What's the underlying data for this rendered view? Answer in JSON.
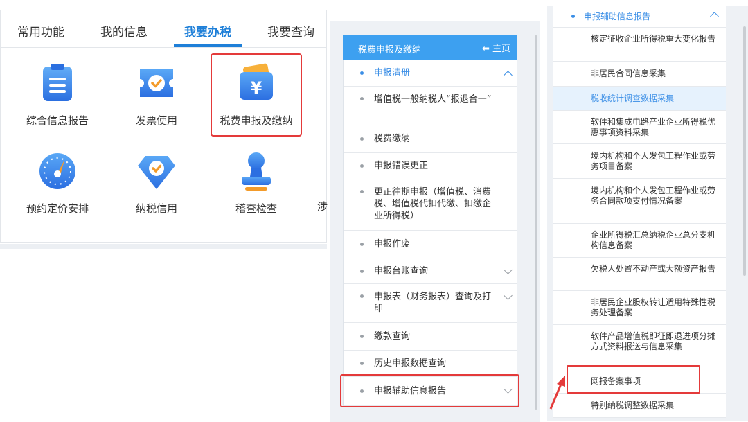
{
  "panel1": {
    "tabs": [
      "常用功能",
      "我的信息",
      "我要办税",
      "我要查询"
    ],
    "active_tab": "我要办税",
    "tiles": [
      {
        "label": "综合信息报告",
        "icon": "report-icon"
      },
      {
        "label": "发票使用",
        "icon": "invoice-icon"
      },
      {
        "label": "税费申报及缴纳",
        "icon": "yuan-wallet-icon"
      },
      {
        "label": "预约定价安排",
        "icon": "compass-icon"
      },
      {
        "label": "纳税信用",
        "icon": "diamond-check-icon"
      },
      {
        "label": "稽查检查",
        "icon": "stamp-icon"
      }
    ],
    "cut_label": "涉"
  },
  "panel2": {
    "header_title": "税费申报及缴纳",
    "home_label": "主页",
    "items": [
      {
        "label": "申报清册",
        "type": "section"
      },
      {
        "label": "增值税一般纳税人“报退合一”"
      },
      {
        "label": "税费缴纳"
      },
      {
        "label": "申报错误更正"
      },
      {
        "label": "更正往期申报（增值税、消费税、增值税代扣代缴、扣缴企业所得税）"
      },
      {
        "label": "申报作废"
      },
      {
        "label": "申报台账查询"
      },
      {
        "label": "申报表（财务报表）查询及打印"
      },
      {
        "label": "缴款查询"
      },
      {
        "label": "历史申报数据查询"
      },
      {
        "label": "申报辅助信息报告"
      }
    ]
  },
  "panel3": {
    "section_title": "申报辅助信息报告",
    "items": [
      "核定征收企业所得税重大变化报告",
      "非居民合同信息采集",
      "税收统计调查数据采集",
      "软件和集成电路产业企业所得税优惠事项资料采集",
      "境内机构和个人发包工程作业或劳务项目备案",
      "境内机构和个人发包工程作业或劳务合同款项支付情况备案",
      "企业所得税汇总纳税企业总分支机构信息备案",
      "欠税人处置不动产或大额资产报告",
      "非居民企业股权转让适用特殊性税务处理备案",
      "软件产品增值税即征即退进项分摊方式资料报送与信息采集",
      "网报备案事项",
      "特别纳税调整数据采集"
    ]
  },
  "colors": {
    "accent": "#1e7fd8",
    "header_blue": "#3da0f0",
    "highlight_red": "#e43a3a"
  }
}
